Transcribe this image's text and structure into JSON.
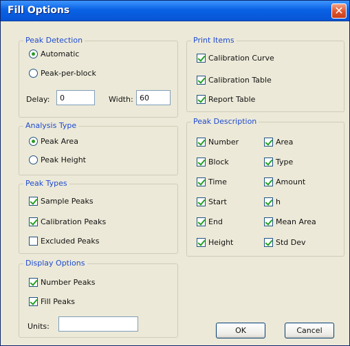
{
  "window": {
    "title": "Fill Options"
  },
  "peak_detection": {
    "group_label": "Peak Detection",
    "automatic_label": "Automatic",
    "peak_per_block_label": "Peak-per-block",
    "delay_label": "Delay:",
    "delay_value": "0",
    "width_label": "Width:",
    "width_value": "60"
  },
  "analysis_type": {
    "group_label": "Analysis Type",
    "peak_area_label": "Peak Area",
    "peak_height_label": "Peak Height"
  },
  "peak_types": {
    "group_label": "Peak Types",
    "sample_label": "Sample Peaks",
    "calibration_label": "Calibration Peaks",
    "excluded_label": "Excluded Peaks"
  },
  "display_options": {
    "group_label": "Display Options",
    "number_peaks_label": "Number Peaks",
    "fill_peaks_label": "Fill Peaks",
    "units_label": "Units:",
    "units_value": ""
  },
  "print_items": {
    "group_label": "Print Items",
    "calibration_curve_label": "Calibration Curve",
    "calibration_table_label": "Calibration Table",
    "report_table_label": "Report Table"
  },
  "peak_description": {
    "group_label": "Peak Description",
    "number": "Number",
    "block": "Block",
    "time": "Time",
    "start": "Start",
    "end": "End",
    "height": "Height",
    "area": "Area",
    "type": "Type",
    "amount": "Amount",
    "n": "h",
    "mean_area": "Mean Area",
    "std_dev": "Std Dev"
  },
  "buttons": {
    "ok": "OK",
    "cancel": "Cancel"
  }
}
